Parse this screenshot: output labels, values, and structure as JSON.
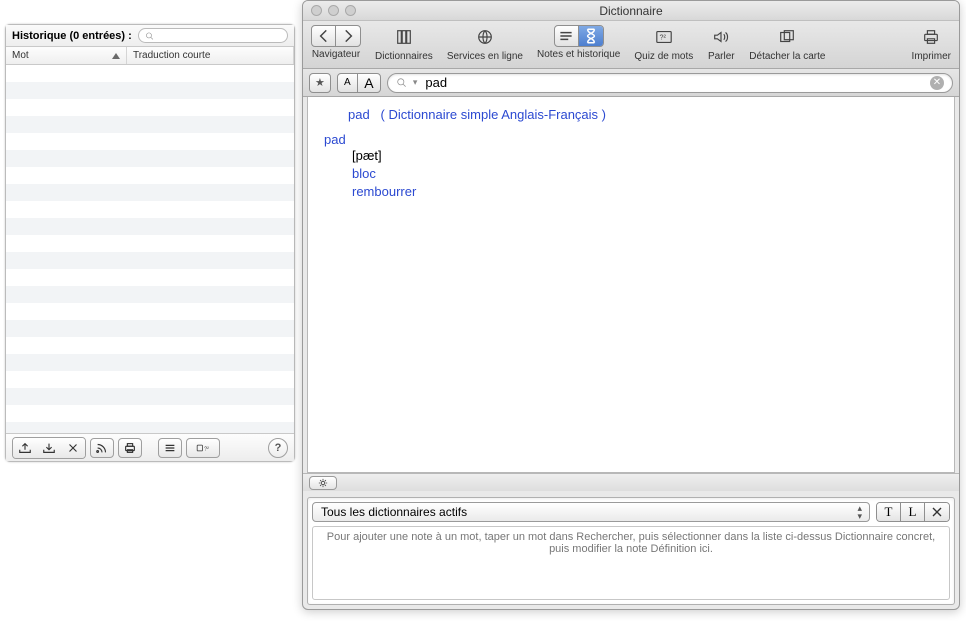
{
  "history": {
    "title": "Historique (0 entrées) :",
    "search_placeholder": "",
    "columns": {
      "word": "Mot",
      "translation": "Traduction courte"
    }
  },
  "window": {
    "title": "Dictionnaire",
    "toolbar": {
      "navigator": "Navigateur",
      "dictionaries": "Dictionnaires",
      "online": "Services en ligne",
      "notes_history": "Notes et historique",
      "quiz": "Quiz de mots",
      "speak": "Parler",
      "detach": "Détacher la carte",
      "print": "Imprimer"
    },
    "font_small": "A",
    "font_large": "A",
    "search_value": "pad",
    "star": "★"
  },
  "entry": {
    "headword": "pad",
    "source_open": "(",
    "source": "Dictionnaire simple Anglais-Français",
    "source_close": ")",
    "word": "pad",
    "ipa": "[pæt]",
    "sense1": "bloc",
    "sense2": "rembourrer"
  },
  "notes": {
    "select_label": "Tous les dictionnaires actifs",
    "btn_t": "T",
    "btn_l": "L",
    "hint": "Pour ajouter une note à un mot, taper un mot dans Rechercher, puis sélectionner dans la liste ci-dessus Dictionnaire concret, puis modifier la note Définition ici."
  }
}
